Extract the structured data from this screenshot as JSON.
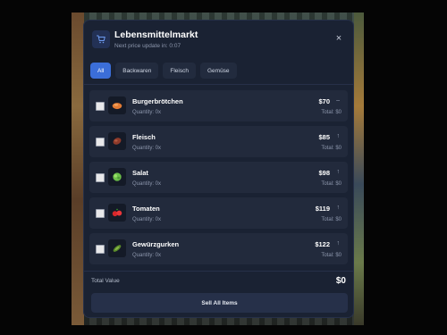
{
  "shop": {
    "title": "Lebensmittelmarkt",
    "subtitle": "Next price update in: 0:07",
    "close_icon": "×"
  },
  "tabs": [
    {
      "label": "All",
      "active": true
    },
    {
      "label": "Backwaren",
      "active": false
    },
    {
      "label": "Fleisch",
      "active": false
    },
    {
      "label": "Gemüse",
      "active": false
    }
  ],
  "items": [
    {
      "name": "Burgerbrötchen",
      "quantity": "Quantity: 0x",
      "price": "$70",
      "trend": "–",
      "total": "Total: $0",
      "icon": "bread-icon"
    },
    {
      "name": "Fleisch",
      "quantity": "Quantity: 0x",
      "price": "$85",
      "trend": "↑",
      "total": "Total: $0",
      "icon": "meat-icon"
    },
    {
      "name": "Salat",
      "quantity": "Quantity: 0x",
      "price": "$98",
      "trend": "↑",
      "total": "Total: $0",
      "icon": "lettuce-icon"
    },
    {
      "name": "Tomaten",
      "quantity": "Quantity: 0x",
      "price": "$119",
      "trend": "↑",
      "total": "Total: $0",
      "icon": "tomato-icon"
    },
    {
      "name": "Gewürzgurken",
      "quantity": "Quantity: 0x",
      "price": "$122",
      "trend": "↑",
      "total": "Total: $0",
      "icon": "pickles-icon"
    }
  ],
  "footer": {
    "total_label": "Total Value",
    "total_value": "$0",
    "sell_label": "Sell All Items"
  },
  "colors": {
    "accent": "#3b6ed8",
    "panel": "#1a2233",
    "row": "#222a3c"
  }
}
